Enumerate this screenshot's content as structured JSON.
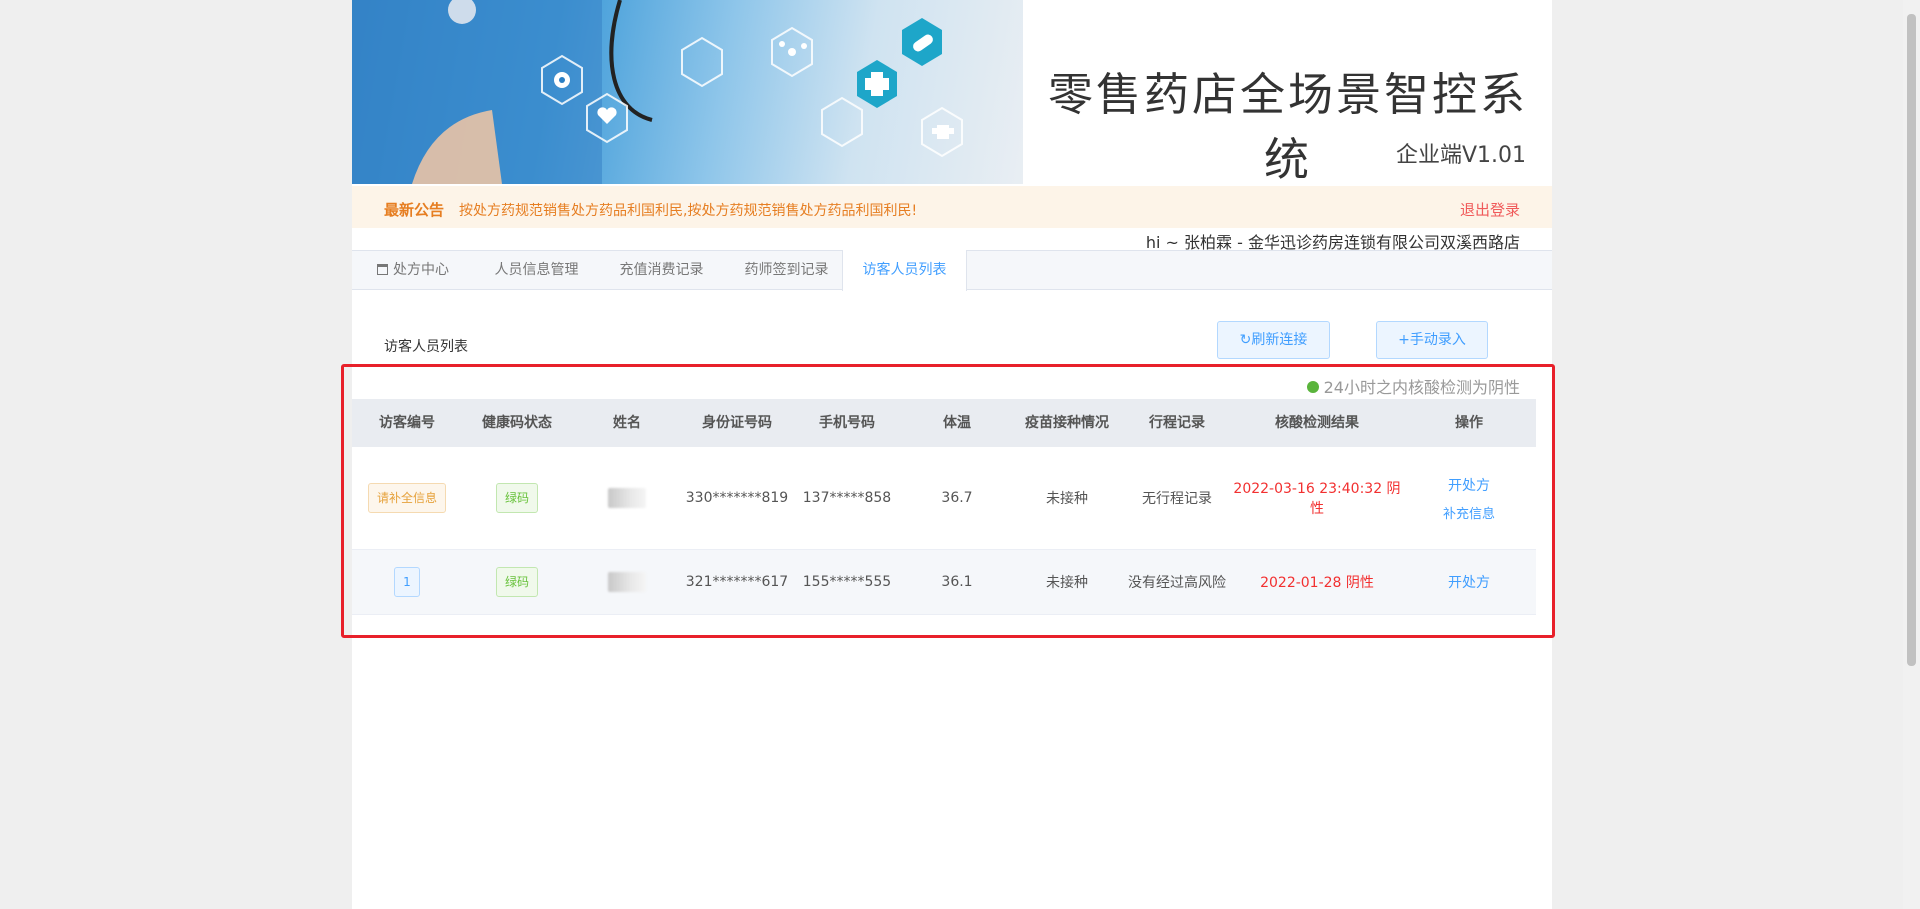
{
  "header": {
    "title": "零售药店全场景智控系统",
    "version": "企业端V1.01",
    "banner_icons": [
      "eye-icon",
      "heart-icon",
      "cross-icon",
      "pill-icon",
      "microscope-icon",
      "molecule-icon"
    ]
  },
  "notice": {
    "label": "最新公告",
    "text": "按处方药规范销售处方药品利国利民,按处方药规范销售处方药品利国利民!",
    "logout": "退出登录"
  },
  "greeting": "hi ~ 张柏霖 - 金华迅诊药房连锁有限公司双溪西路店",
  "tabs": [
    "处方中心",
    "人员信息管理",
    "充值消费记录",
    "药师签到记录",
    "访客人员列表"
  ],
  "active_tab": 4,
  "main": {
    "list_title": "访客人员列表",
    "refresh_button": "刷新连接",
    "add_button": "+手动录入",
    "legend": "24小时之内核酸检测为阴性"
  },
  "table": {
    "headers": [
      "访客编号",
      "健康码状态",
      "姓名",
      "身份证号码",
      "手机号码",
      "体温",
      "疫苗接种情况",
      "行程记录",
      "核酸检测结果",
      "操作"
    ],
    "rows": [
      {
        "id": "请补全信息",
        "health_code": "绿码",
        "name": "",
        "id_card": "330*******819",
        "phone": "137*****858",
        "temperature": "36.7",
        "vaccine": "未接种",
        "trip": "无行程记录",
        "nucleic": "2022-03-16 23:40:32 阴性",
        "action_primary": "开处方",
        "action_secondary": "补充信息"
      },
      {
        "id": "1",
        "health_code": "绿码",
        "name": "",
        "id_card": "321*******617",
        "phone": "155*****555",
        "temperature": "36.1",
        "vaccine": "未接种",
        "trip": "没有经过高风险",
        "nucleic": "2022-01-28 阴性",
        "action_primary": "开处方"
      }
    ]
  },
  "colors": {
    "accent": "#409eff",
    "notice_text": "#e67e22",
    "negative_red": "#f23030",
    "highlight": "#e8202a",
    "legend_dot": "#5ab43c"
  }
}
